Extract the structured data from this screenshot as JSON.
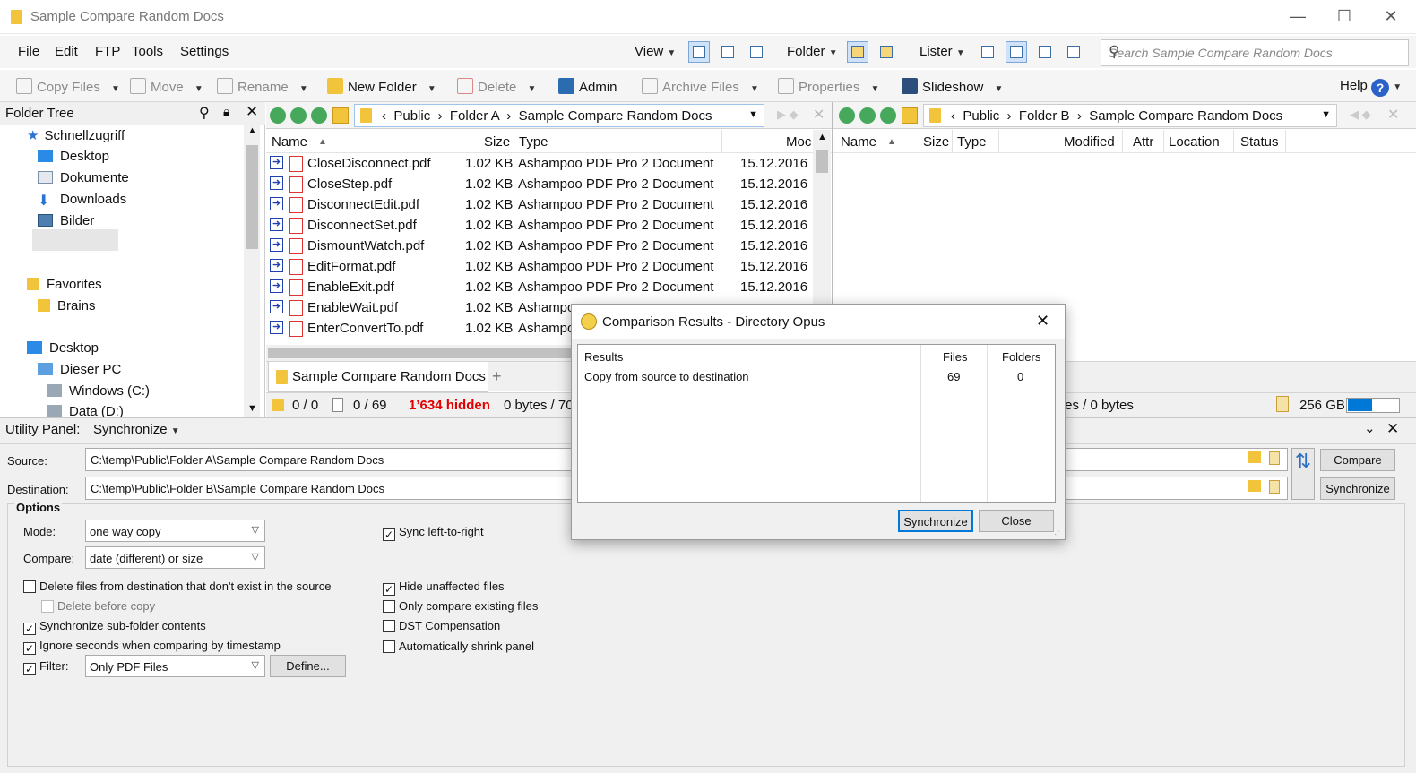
{
  "window": {
    "title": "Sample Compare Random Docs"
  },
  "menu": [
    "File",
    "Edit",
    "FTP",
    "Tools",
    "Settings"
  ],
  "menu_right": {
    "view": "View",
    "folder": "Folder",
    "lister": "Lister"
  },
  "search": {
    "placeholder": "Search Sample Compare Random Docs"
  },
  "toolbar": {
    "copy_files": "Copy Files",
    "move": "Move",
    "rename": "Rename",
    "new_folder": "New Folder",
    "delete": "Delete",
    "admin": "Admin",
    "archive_files": "Archive Files",
    "properties": "Properties",
    "slideshow": "Slideshow",
    "help": "Help"
  },
  "folder_tree": {
    "title": "Folder Tree",
    "items": [
      "Schnellzugriff",
      "Desktop",
      "Dokumente",
      "Downloads",
      "Bilder",
      "Favorites",
      "Brains",
      "Desktop",
      "Dieser PC",
      "Windows  (C:)",
      "Data (D:)"
    ]
  },
  "left_pane": {
    "breadcrumb": [
      "Public",
      "Folder A",
      "Sample Compare Random Docs"
    ],
    "columns": [
      "Name",
      "Size",
      "Type",
      "Moc"
    ],
    "files": [
      {
        "name": "CloseDisconnect.pdf",
        "size": "1.02 KB",
        "type": "Ashampoo PDF Pro 2 Document",
        "modified": "15.12.2016"
      },
      {
        "name": "CloseStep.pdf",
        "size": "1.02 KB",
        "type": "Ashampoo PDF Pro 2 Document",
        "modified": "15.12.2016"
      },
      {
        "name": "DisconnectEdit.pdf",
        "size": "1.02 KB",
        "type": "Ashampoo PDF Pro 2 Document",
        "modified": "15.12.2016"
      },
      {
        "name": "DisconnectSet.pdf",
        "size": "1.02 KB",
        "type": "Ashampoo PDF Pro 2 Document",
        "modified": "15.12.2016"
      },
      {
        "name": "DismountWatch.pdf",
        "size": "1.02 KB",
        "type": "Ashampoo PDF Pro 2 Document",
        "modified": "15.12.2016"
      },
      {
        "name": "EditFormat.pdf",
        "size": "1.02 KB",
        "type": "Ashampoo PDF Pro 2 Document",
        "modified": "15.12.2016"
      },
      {
        "name": "EnableExit.pdf",
        "size": "1.02 KB",
        "type": "Ashampoo PDF Pro 2 Document",
        "modified": "15.12.2016"
      },
      {
        "name": "EnableWait.pdf",
        "size": "1.02 KB",
        "type": "Ashampoo",
        "modified": ""
      },
      {
        "name": "EnterConvertTo.pdf",
        "size": "1.02 KB",
        "type": "Ashampoo",
        "modified": ""
      }
    ],
    "tab": "Sample Compare Random Docs",
    "tab_add": "+",
    "status": {
      "folders": "0 / 0",
      "files": "0 / 69",
      "hidden": "1’634 hidden",
      "bytes": "0 bytes / 70"
    }
  },
  "right_pane": {
    "breadcrumb": [
      "Public",
      "Folder B",
      "Sample Compare Random Docs"
    ],
    "columns": [
      "Name",
      "Size",
      "Type",
      "Modified",
      "Attr",
      "Location",
      "Status"
    ],
    "status": {
      "bytes": "tes / 0 bytes",
      "free": "256 GB"
    }
  },
  "utility": {
    "title": "Utility Panel:",
    "mode_name": "Synchronize",
    "source_label": "Source:",
    "source_value": "C:\\temp\\Public\\Folder A\\Sample Compare Random Docs",
    "dest_label": "Destination:",
    "dest_value": "C:\\temp\\Public\\Folder B\\Sample Compare Random Docs",
    "compare_btn": "Compare",
    "sync_btn": "Synchronize",
    "options_label": "Options",
    "mode_label": "Mode:",
    "mode_value": "one way copy",
    "compare_label": "Compare:",
    "compare_value": "date (different) or size",
    "filter_label": "Filter:",
    "filter_value": "Only PDF Files",
    "define_btn": "Define...",
    "check_left": [
      {
        "label": "Delete files from destination that don't exist in the source",
        "checked": false
      },
      {
        "label": "Delete before copy",
        "checked": false
      },
      {
        "label": "Synchronize sub-folder contents",
        "checked": true
      },
      {
        "label": "Ignore seconds when comparing by timestamp",
        "checked": true
      }
    ],
    "check_right": [
      {
        "label": "Sync left-to-right",
        "checked": true
      },
      {
        "label": "Hide unaffected files",
        "checked": true
      },
      {
        "label": "Only compare existing files",
        "checked": false
      },
      {
        "label": "DST Compensation",
        "checked": false
      },
      {
        "label": "Automatically shrink panel",
        "checked": false
      }
    ]
  },
  "dialog": {
    "title": "Comparison Results - Directory Opus",
    "col_results": "Results",
    "col_files": "Files",
    "col_folders": "Folders",
    "row_label": "Copy from source to destination",
    "row_files": "69",
    "row_folders": "0",
    "synchronize_btn": "Synchronize",
    "close_btn": "Close"
  },
  "colors": {
    "accent": "#0078d7",
    "hidden_red": "#e00000",
    "highlight": "#cfe2f7"
  }
}
